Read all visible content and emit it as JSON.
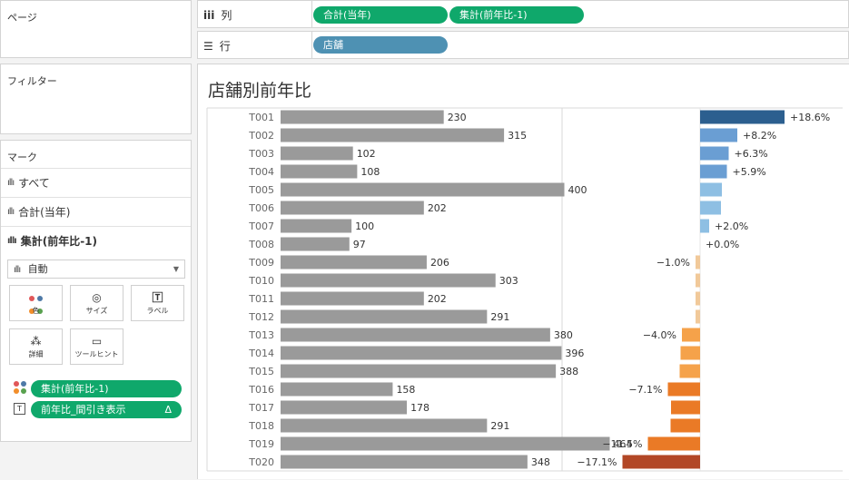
{
  "pages_panel": {
    "title": "ページ"
  },
  "filters_panel": {
    "title": "フィルター"
  },
  "marks_panel": {
    "title": "マーク",
    "rows": [
      {
        "label": "すべて",
        "bold": false
      },
      {
        "label": "合計(当年)",
        "bold": false
      },
      {
        "label": "集計(前年比-1)",
        "bold": true
      }
    ],
    "mark_type": "自動",
    "buttons": [
      {
        "label": "色",
        "icon": "color-icon"
      },
      {
        "label": "サイズ",
        "icon": "size-icon"
      },
      {
        "label": "ラベル",
        "icon": "label-icon"
      },
      {
        "label": "詳細",
        "icon": "detail-icon"
      },
      {
        "label": "ツールヒント",
        "icon": "tooltip-icon"
      }
    ],
    "pills": [
      {
        "label": "集計(前年比-1)",
        "icon": "color-dots-icon",
        "suffix": ""
      },
      {
        "label": "前年比_間引き表示",
        "icon": "text-icon",
        "suffix": "Δ"
      }
    ]
  },
  "shelves": {
    "columns_label": "列",
    "columns_pills": [
      "合計(当年)",
      "集計(前年比-1)"
    ],
    "rows_label": "行",
    "rows_pills": [
      "店舗"
    ]
  },
  "colors": {
    "pill_green": "#0fa86b",
    "pill_blue": "#4e91b3",
    "bar_gray": "#9a9a9a",
    "pos_dark": "#2c5f8f",
    "pos_mid": "#6a9ed3",
    "pos_light": "#8ebfe3",
    "neg_light": "#f1c99a",
    "neg_mid": "#f5a24a",
    "neg_orange": "#ea7a26",
    "neg_dark": "#b24726"
  },
  "chart_data": {
    "type": "bar",
    "title": "店舗別前年比",
    "categories": [
      "T001",
      "T002",
      "T003",
      "T004",
      "T005",
      "T006",
      "T007",
      "T008",
      "T009",
      "T010",
      "T011",
      "T012",
      "T013",
      "T014",
      "T015",
      "T016",
      "T017",
      "T018",
      "T019",
      "T020"
    ],
    "series": [
      {
        "name": "合計(当年)",
        "values": [
          230,
          315,
          102,
          108,
          400,
          202,
          100,
          97,
          206,
          303,
          202,
          291,
          380,
          396,
          388,
          158,
          178,
          291,
          464,
          348
        ]
      },
      {
        "name": "集計(前年比-1)",
        "values": [
          18.6,
          8.2,
          6.3,
          5.9,
          4.8,
          4.6,
          2.0,
          0.0,
          -1.0,
          -1.0,
          -1.0,
          -1.0,
          -4.0,
          -4.3,
          -4.5,
          -7.1,
          -6.4,
          -6.5,
          -11.5,
          -17.1
        ]
      }
    ],
    "yoy_labels": [
      "+18.6%",
      "+8.2%",
      "+6.3%",
      "+5.9%",
      "",
      "",
      "+2.0%",
      "+0.0%",
      "−1.0%",
      "",
      "",
      "",
      "−4.0%",
      "",
      "",
      "−7.1%",
      "",
      "",
      "−11.5%",
      "−17.1%"
    ],
    "sales_range": [
      0,
      480
    ],
    "yoy_range": [
      -22,
      25
    ]
  }
}
